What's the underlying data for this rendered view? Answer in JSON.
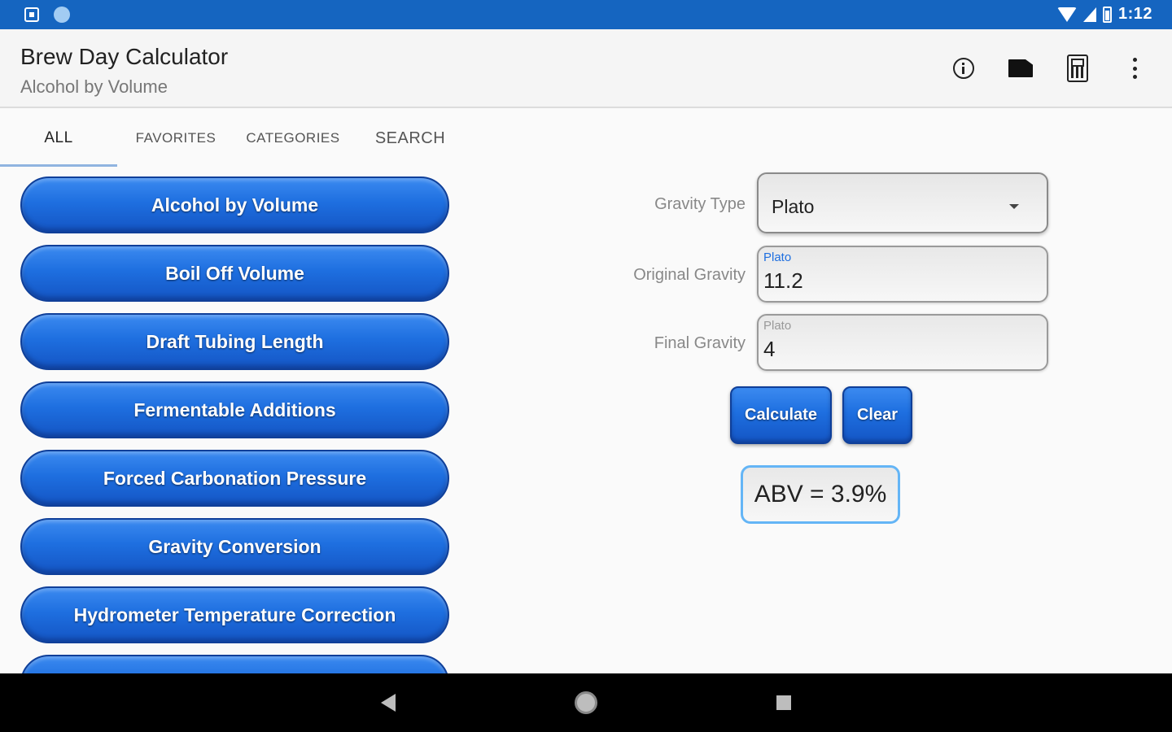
{
  "status_bar": {
    "time": "1:12"
  },
  "app_bar": {
    "title": "Brew Day Calculator",
    "subtitle": "Alcohol by Volume",
    "actions": [
      "info-icon",
      "folder-icon",
      "calculator-icon",
      "more-vert-icon"
    ]
  },
  "tabs": [
    {
      "label": "ALL",
      "active": true
    },
    {
      "label": "FAVORITES",
      "active": false
    },
    {
      "label": "CATEGORIES",
      "active": false
    },
    {
      "label": "SEARCH",
      "active": false
    }
  ],
  "calculators": [
    "Alcohol by Volume",
    "Boil Off Volume",
    "Draft Tubing Length",
    "Fermentable Additions",
    "Forced Carbonation Pressure",
    "Gravity Conversion",
    "Hydrometer Temperature Correction",
    ""
  ],
  "form": {
    "gravity_type": {
      "label": "Gravity Type",
      "value": "Plato"
    },
    "original_gravity": {
      "label": "Original Gravity",
      "hint": "Plato",
      "value": "11.2"
    },
    "final_gravity": {
      "label": "Final Gravity",
      "hint": "Plato",
      "value": "4"
    },
    "calculate_label": "Calculate",
    "clear_label": "Clear",
    "result": "ABV = 3.9%"
  },
  "colors": {
    "primary": "#1565c0",
    "button": "#1e6fe0",
    "accent_hint": "#1e6fe0"
  }
}
